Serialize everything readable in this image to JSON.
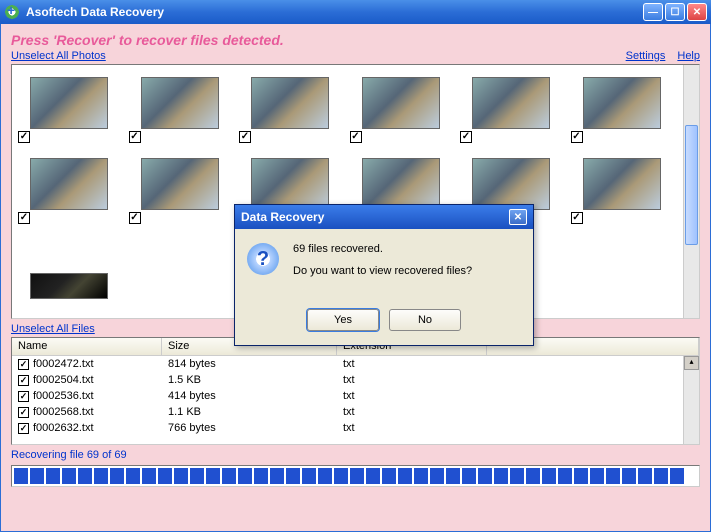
{
  "titlebar": {
    "title": "Asoftech Data Recovery"
  },
  "instruction": "Press 'Recover' to recover files detected.",
  "links": {
    "unselect_photos": "Unselect All Photos",
    "settings": "Settings",
    "help": "Help",
    "unselect_files": "Unselect All Files"
  },
  "files": {
    "headers": {
      "name": "Name",
      "size": "Size",
      "ext": "Extension"
    },
    "rows": [
      {
        "name": "f0002472.txt",
        "size": "814 bytes",
        "ext": "txt"
      },
      {
        "name": "f0002504.txt",
        "size": "1.5 KB",
        "ext": "txt"
      },
      {
        "name": "f0002536.txt",
        "size": "414 bytes",
        "ext": "txt"
      },
      {
        "name": "f0002568.txt",
        "size": "1.1 KB",
        "ext": "txt"
      },
      {
        "name": "f0002632.txt",
        "size": "766 bytes",
        "ext": "txt"
      }
    ]
  },
  "progress": {
    "label": "Recovering file 69 of 69"
  },
  "dialog": {
    "title": "Data Recovery",
    "msg1": "69 files recovered.",
    "msg2": "Do you want to view recovered files?",
    "yes": "Yes",
    "no": "No"
  }
}
